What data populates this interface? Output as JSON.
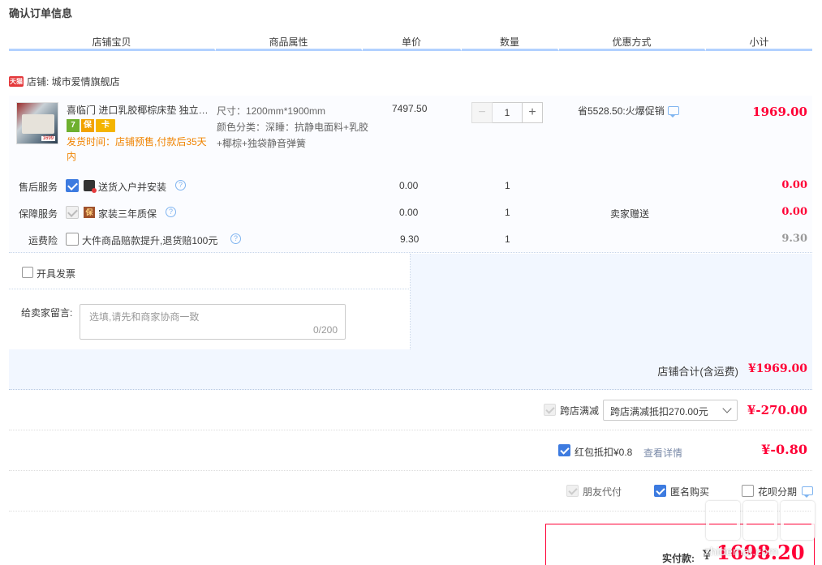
{
  "page_title": "确认订单信息",
  "columns": [
    "店铺宝贝",
    "商品属性",
    "单价",
    "数量",
    "优惠方式",
    "小计"
  ],
  "shop": {
    "badge": "天猫",
    "label": "店铺: 城市爱情旗舰店"
  },
  "item": {
    "title": "喜临门 进口乳胶椰棕床垫 独立弹簧",
    "tags": [
      "7",
      "保",
      "卡"
    ],
    "ship_time": "发货时间：店铺预售,付款后35天内",
    "thumb_price": "1699",
    "attr_size": "尺寸：1200mm*1900mm",
    "attr_color": "颜色分类：深睡：抗静电面料+乳胶+椰棕+独袋静音弹簧",
    "unit_price": "7497.50",
    "quantity": "1",
    "minus": "−",
    "plus": "+",
    "promo": "省5528.50:火爆促销",
    "subtotal": "1969.00"
  },
  "services": [
    {
      "label": "售后服务",
      "icon_text": "",
      "text": "送货入户并安装",
      "price": "0.00",
      "qty": "1",
      "promo": "",
      "subtotal": "0.00"
    },
    {
      "label": "保障服务",
      "icon_text": "保",
      "text": "家装三年质保",
      "price": "0.00",
      "qty": "1",
      "promo": "卖家赠送",
      "subtotal": "0.00"
    },
    {
      "label": "运费险",
      "icon_text": "",
      "text": "大件商品赔款提升,退货赔100元",
      "price": "9.30",
      "qty": "1",
      "promo": "",
      "subtotal": "9.30"
    }
  ],
  "help_glyph": "?",
  "invoice": {
    "label": "开具发票"
  },
  "message": {
    "label": "给卖家留言:",
    "placeholder": "选填,请先和商家协商一致",
    "count": "0/200"
  },
  "shop_total": {
    "label": "店铺合计(含运费)",
    "value": "¥1969.00"
  },
  "cross_shop": {
    "label": "跨店满减",
    "selected": "跨店满减抵扣270.00元",
    "value": "¥-270.00"
  },
  "red_packet": {
    "label": "红包抵扣¥0.8",
    "link": "查看详情",
    "value": "¥-0.80"
  },
  "options": {
    "friend_pay": "朋友代付",
    "anonymous": "匿名购买",
    "installment": "花呗分期"
  },
  "payment": {
    "label": "实付款:",
    "currency": "¥",
    "value": "1698.20"
  },
  "watermark": {
    "text": "zhidemai.com"
  },
  "colors": {
    "price_red": "#ff0036",
    "accent_blue": "#3d7be0",
    "header_line": "#b2d1ff",
    "ship_orange": "#f08300"
  }
}
